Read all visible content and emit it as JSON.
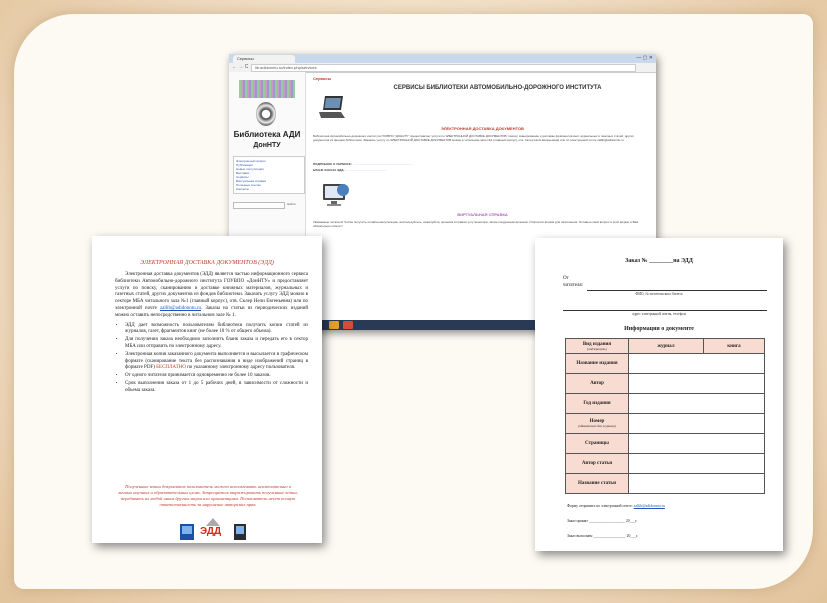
{
  "browser": {
    "tab_title": "Сервисы",
    "window_controls": "— ▢ ✕",
    "nav": "← → C",
    "url": "lib.adidonntu.ru/index.php/services",
    "library_name": "Библиотека АДИ",
    "library_org": "ДонНТУ",
    "menu_items": [
      "Электронный каталог",
      "Публикации",
      "Новые поступления",
      "Выставки",
      "Сервисы",
      "Виртуальная справка",
      "Полезные ссылки",
      "Контакты"
    ],
    "search_button": "Найти",
    "breadcrumb": "Сервисы",
    "heading": "СЕРВИСЫ БИБЛИОТЕКИ АВТОМОБИЛЬНО-ДОРОЖНОГО ИНСТИТУТА",
    "section1_title": "ЭЛЕКТРОННАЯ ДОСТАВКА ДОКУМЕНТОВ",
    "section1_text": "Библиотека Автомобильно-дорожного института ГОУВПО \"ДОННТУ\" предоставляет услуги по ЭЛЕКТРОННОЙ ДОСТАВКЕ ДОКУМЕНТОВ: поиску, сканированию и доставке фрагментов книг, журнальных и газетных статей, других документов из фондов библиотеки. Заказать услугу по ЭЛЕКТРОННОЙ ДОСТАВКЕ ДОКУМЕНТОВ можно в читальном зале №1 (главный корпус), отв. Склер Нели Евгеньевна) или по электронной почте zallib@adidonntu.ru",
    "link1_label": "ПОДРОБНЕЕ О СЕРВИСЕ:",
    "link2_label": "БЛАНК ЗАКАЗА ЭДД:",
    "section2_title": "ВИРТУАЛЬНАЯ СПРАВКА",
    "section2_text": "Уважаемые читатели! Чтобы получить онлайн-консультацию, воспользуйтесь, пожалуйста, ярлыком в правом углу монитора, затем следующим ярлыком. Откроется форма для заполнения. Оставьте свой вопрос в этой форме и Вам обязательно ответят!"
  },
  "doc_left": {
    "title": "ЭЛЕКТРОННАЯ ДОСТАВКА ДОКУМЕНТОВ (ЭДД)",
    "intro": "Электронная доставка документов (ЭДД) является частью информационного сервиса библиотеки Автомобильно-дорожного института ГОУВПО «ДонНТУ» и предоставляет услуги по поиску, сканированию и доставке книжных материалов, журнальных и газетных статей, других документов из фондов библиотеки. Заказать услугу ЭДД можно в секторе МБА читального зала №1 (главный корпус), отв. Склер Нели Евгеньевна) или по электронной почте",
    "email": "zallib@adidonntu.ru",
    "intro_tail": ". Заказы на статьи из периодических изданий можно оставить непосредственно в читальном зале № 1.",
    "bullets": [
      "ЭДД дает возможность пользователям библиотеки получить копии статей из журналов, газет, фрагментов книг (не более 10 % от общего объема).",
      "Для получения заказа необходимо заполнить бланк заказа и передать его в сектор МБА или отправить по электронному адресу.",
      "Электронная копия заказанного документа выполняется и высылается в графическом формате (сканирование текста без распознавания в виде изображений страниц в формате PDF)",
      "От одного читателя принимается одновременно не более 10 заказов.",
      "Срок выполнения заказа от 1 до 5 рабочих дней, в зависимости от сложности и объема заказа."
    ],
    "free_word": "БЕСПЛАТНО",
    "free_tail": "по указанному электронному адресу пользователя.",
    "note": "Полученные копии документов пользователь может использовать исключительно в личных научных и образовательных целях. Запрещается тиражировать полученные копии, передавать их любой иным другим лицам или организациям. Пользователь несет полную ответственность за нарушение авторских прав.",
    "logo_text": "ЭДД"
  },
  "doc_right": {
    "order_label": "Заказ №",
    "order_suffix": "на ЭДД",
    "from_label": "От",
    "reader_label": "читателя:",
    "reader_hint": "ФИО, № читательского билета",
    "contact_hint": "адрес электронной почты, телефон",
    "info_title": "Информация о документе",
    "table_head": [
      "Вид издания",
      "журнал",
      "книга"
    ],
    "table_head_sub": "(подчеркнуть)",
    "rows": [
      "Название издания",
      "Автор",
      "Год издания",
      "Номер",
      "Страницы",
      "Автор статьи",
      "Название статьи"
    ],
    "number_sub": "(обязательно для журнала)",
    "send_text": "Форму отправить по электронной почте:",
    "send_email": "zallib@adidonntu.ru",
    "accepted": "Заказ принят",
    "year_mark": "20___г.",
    "completed": "Заказ выполнен"
  },
  "colors": {
    "accent_red": "#c0392b",
    "chat_purple": "#b8368f",
    "header_fill": "#f9dcd1"
  }
}
